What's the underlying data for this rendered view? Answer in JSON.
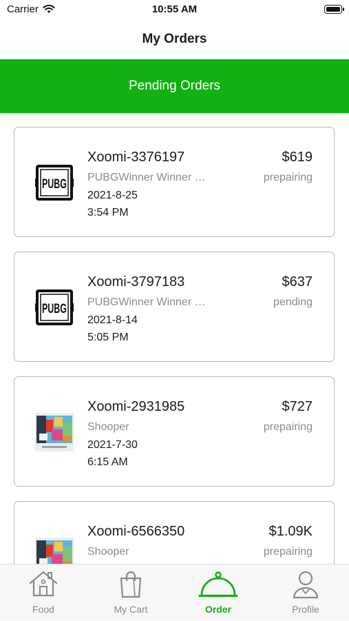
{
  "status_bar": {
    "carrier": "Carrier",
    "time": "10:55 AM"
  },
  "nav": {
    "title": "My Orders"
  },
  "banner": {
    "label": "Pending Orders"
  },
  "orders": [
    {
      "id": "Xoomi-3376197",
      "store": "PUBGWinner Winner Chicken Dinner",
      "date": "2021-8-25",
      "time": "3:54 PM",
      "price": "$619",
      "status": "prepairing",
      "thumb": "pubg-logo"
    },
    {
      "id": "Xoomi-3797183",
      "store": "PUBGWinner Winner Chicken Dinner",
      "date": "2021-8-14",
      "time": "5:05 PM",
      "price": "$637",
      "status": "pending",
      "thumb": "pubg-logo"
    },
    {
      "id": "Xoomi-2931985",
      "store": "Shooper",
      "date": "2021-7-30",
      "time": "6:15 AM",
      "price": "$727",
      "status": "prepairing",
      "thumb": "shooper-image"
    },
    {
      "id": "Xoomi-6566350",
      "store": "Shooper",
      "date": "",
      "time": "",
      "price": "$1.09K",
      "status": "prepairing",
      "thumb": "shooper-image"
    }
  ],
  "tabbar": {
    "items": [
      {
        "label": "Food",
        "icon": "house-icon"
      },
      {
        "label": "My Cart",
        "icon": "shopping-bag-icon"
      },
      {
        "label": "Order",
        "icon": "cloche-icon"
      },
      {
        "label": "Profile",
        "icon": "person-icon"
      }
    ],
    "active_index": 2
  },
  "colors": {
    "accent": "#12b012",
    "muted_text": "#8b8b8b",
    "card_border": "#b8b8b8"
  }
}
